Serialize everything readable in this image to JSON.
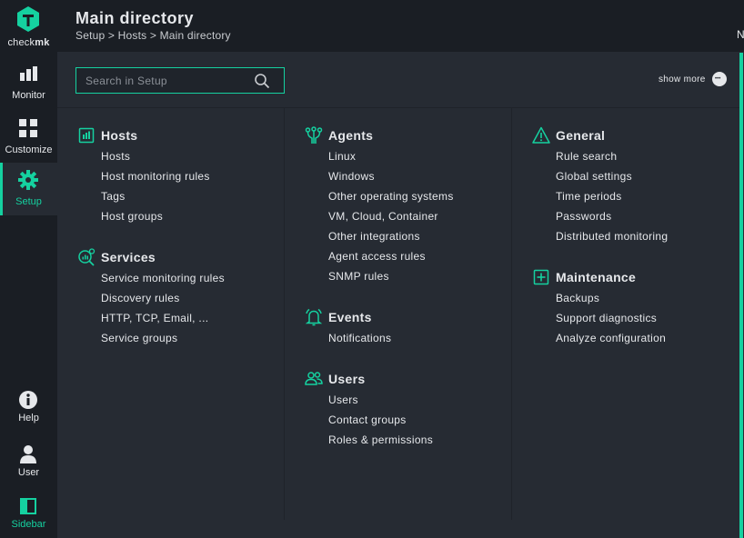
{
  "app": {
    "brand_prefix": "check",
    "brand_suffix": "mk",
    "accent": "#15d1a0"
  },
  "nav": {
    "monitor": "Monitor",
    "customize": "Customize",
    "setup": "Setup",
    "help": "Help",
    "user": "User",
    "sidebar": "Sidebar"
  },
  "header": {
    "title": "Main directory",
    "breadcrumb": "Setup > Hosts > Main directory",
    "edge_text": "N"
  },
  "search": {
    "placeholder": "Search in Setup"
  },
  "show_more": "show more",
  "columns": [
    {
      "sections": [
        {
          "title": "Hosts",
          "icon": "hosts-icon",
          "links": [
            "Hosts",
            "Host monitoring rules",
            "Tags",
            "Host groups"
          ]
        },
        {
          "title": "Services",
          "icon": "services-icon",
          "links": [
            "Service monitoring rules",
            "Discovery rules",
            "HTTP, TCP, Email, ...",
            "Service groups"
          ]
        }
      ]
    },
    {
      "sections": [
        {
          "title": "Agents",
          "icon": "agents-icon",
          "links": [
            "Linux",
            "Windows",
            "Other operating systems",
            "VM, Cloud, Container",
            "Other integrations",
            "Agent access rules",
            "SNMP rules"
          ]
        },
        {
          "title": "Events",
          "icon": "events-bell-icon",
          "links": [
            "Notifications"
          ]
        },
        {
          "title": "Users",
          "icon": "users-icon",
          "links": [
            "Users",
            "Contact groups",
            "Roles & permissions"
          ]
        }
      ]
    },
    {
      "sections": [
        {
          "title": "General",
          "icon": "general-warning-icon",
          "links": [
            "Rule search",
            "Global settings",
            "Time periods",
            "Passwords",
            "Distributed monitoring"
          ]
        },
        {
          "title": "Maintenance",
          "icon": "maintenance-icon",
          "links": [
            "Backups",
            "Support diagnostics",
            "Analyze configuration"
          ]
        }
      ]
    }
  ]
}
